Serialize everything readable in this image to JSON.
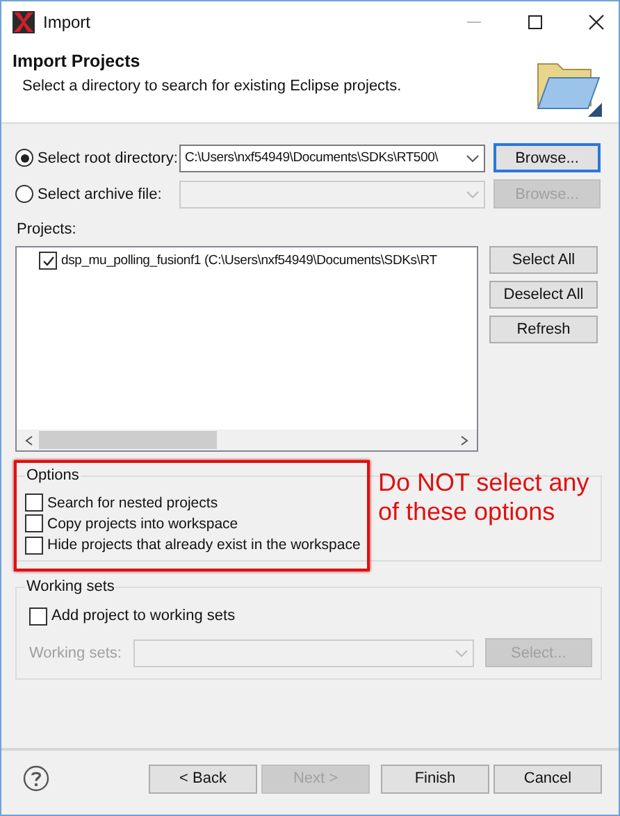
{
  "window": {
    "title": "Import"
  },
  "header": {
    "title": "Import Projects",
    "description": "Select a directory to search for existing Eclipse projects."
  },
  "sources": [
    {
      "label": "Select root directory:",
      "selected": true,
      "value": "C:\\Users\\nxf54949\\Documents\\SDKs\\RT500\\",
      "disabled": false,
      "button": "Browse..."
    },
    {
      "label": "Select archive file:",
      "selected": false,
      "disabled": true,
      "button": "Browse..."
    }
  ],
  "projects": {
    "label": "Projects:",
    "items": [
      {
        "label": "dsp_mu_polling_fusionf1 (C:\\Users\\nxf54949\\Documents\\SDKs\\RT",
        "checked": true
      }
    ],
    "buttons": [
      "Select All",
      "Deselect All",
      "Refresh"
    ]
  },
  "options": {
    "title": "Options",
    "items": [
      {
        "label": "Search for nested projects",
        "checked": false
      },
      {
        "label": "Copy projects into workspace",
        "checked": false
      },
      {
        "label": "Hide projects that already exist in the workspace",
        "checked": false
      }
    ]
  },
  "annotation": {
    "text": "Do NOT select any of these options"
  },
  "working_sets": {
    "title": "Working sets",
    "checkbox": {
      "label": "Add project to working sets",
      "checked": false
    },
    "field_label": "Working sets:",
    "disabled": true,
    "button": "Select..."
  },
  "footer_buttons": [
    {
      "label": "< Back",
      "disabled": false
    },
    {
      "label": "Next >",
      "disabled": true
    },
    {
      "label": "Finish",
      "disabled": false
    },
    {
      "label": "Cancel",
      "disabled": false
    }
  ]
}
